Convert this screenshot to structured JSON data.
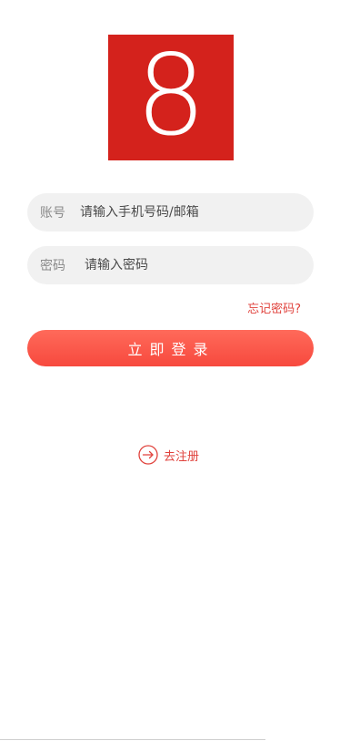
{
  "logo": {
    "char": "8",
    "bg_color": "#d4221c"
  },
  "form": {
    "account": {
      "label": "账号",
      "placeholder": "请输入手机号码/邮箱"
    },
    "password": {
      "label": "密码",
      "placeholder": "请输入密码"
    },
    "forgot_label": "忘记密码?",
    "login_label": "立即登录"
  },
  "register": {
    "label": "去注册",
    "icon": "arrow-right-circle-icon"
  },
  "colors": {
    "accent": "#e0423c",
    "button_top": "#ff6a5a",
    "button_bottom": "#f7493e",
    "field_bg": "#f1f1f1"
  }
}
